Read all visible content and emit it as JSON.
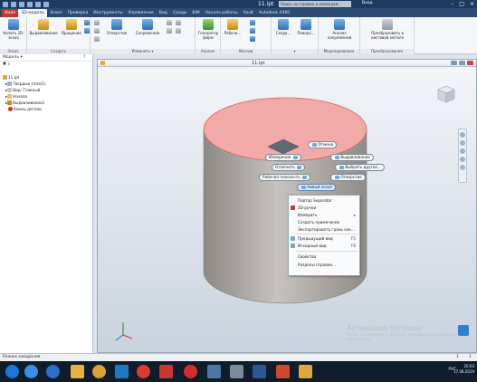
{
  "titlebar": {
    "document_title": "11.ipt",
    "search_placeholder": "Поиск по справке и командам",
    "sign_in": "Вход"
  },
  "ribbon_tabs": [
    "Файл",
    "3D-модель",
    "Эскиз",
    "Проверка",
    "Инструменты",
    "Управление",
    "Вид",
    "Среды",
    "BIM",
    "Начало работы",
    "Vault",
    "Autodesk A360"
  ],
  "ribbon": {
    "groups": [
      {
        "name": "Эскиз",
        "buttons": [
          "Начать 2D-эскиз"
        ]
      },
      {
        "name": "Создать",
        "buttons": [
          "Выдавливание",
          "Вращение"
        ]
      },
      {
        "name": "Изменить",
        "buttons": [
          "Отверстие",
          "Сопряжение"
        ]
      },
      {
        "name": "Анализ",
        "buttons": [
          "Генератор форм"
        ]
      },
      {
        "name": "Массив",
        "buttons": [
          "Рабочи..."
        ]
      },
      {
        "name": "",
        "buttons": [
          "Созда...",
          "Поверх..."
        ]
      },
      {
        "name": "Моделирование",
        "buttons": [
          "Анализ напряжений"
        ]
      },
      {
        "name": "Преобразование",
        "buttons": [
          "Преобразовать в листовой металл"
        ]
      }
    ]
  },
  "browser": {
    "title": "Модель",
    "items": [
      "11.ipt",
      "Твердые тела(1)",
      "Вид: Главный",
      "Начало",
      "Выдавливание1",
      "Конец детали"
    ]
  },
  "document": {
    "tab_title": "11.ipt"
  },
  "marking_menu": {
    "north": "Отмена",
    "northeast": "Выдавливание",
    "west_top": "Измерение",
    "west": "Отменить",
    "east": "Выбрать другое...",
    "southwest": "Рабочая плоскость",
    "southeast": "Отверстие",
    "south": "Новый эскиз"
  },
  "context_menu": {
    "items": [
      {
        "label": "Повтор Separator",
        "shortcut": ""
      },
      {
        "label": "3D-ручки",
        "shortcut": ""
      },
      {
        "label": "Измерить",
        "shortcut": "▸"
      },
      {
        "label": "Создать примечание",
        "shortcut": ""
      },
      {
        "label": "Экспортировать грань как...",
        "shortcut": ""
      },
      {
        "label": "Предыдущий вид",
        "shortcut": "F5"
      },
      {
        "label": "Исходный вид",
        "shortcut": "F6"
      },
      {
        "label": "Свойства",
        "shortcut": ""
      },
      {
        "label": "Разделы справки...",
        "shortcut": ""
      }
    ]
  },
  "watermark": {
    "line1": "Активация Windows",
    "line2": "Чтобы активировать Windows, перейдите в параметры компьютера."
  },
  "statusbar": {
    "text": "Режим ожидания",
    "page_a": "1",
    "page_b": "1"
  },
  "tray": {
    "language": "РУС",
    "time": "20:03",
    "date": "17.08.2019"
  },
  "colors": {
    "top_face": "#f0a8a8",
    "side_face": "#b9b5b0",
    "accent": "#c0392b"
  }
}
